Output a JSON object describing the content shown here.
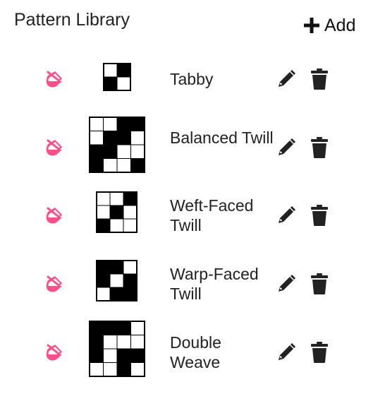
{
  "header": {
    "title": "Pattern Library",
    "add_label": "Add",
    "add_icon": "plus-icon"
  },
  "colors": {
    "accent": "#ff4f86",
    "icon_dark": "#222222"
  },
  "patterns": [
    {
      "name": "Tabby",
      "grid": [
        [
          0,
          1
        ],
        [
          1,
          0
        ]
      ]
    },
    {
      "name": "Balanced Twill",
      "grid": [
        [
          0,
          0,
          1,
          1
        ],
        [
          0,
          1,
          1,
          0
        ],
        [
          1,
          1,
          0,
          0
        ],
        [
          1,
          0,
          0,
          1
        ]
      ]
    },
    {
      "name": "Weft-Faced Twill",
      "grid": [
        [
          0,
          0,
          1
        ],
        [
          0,
          1,
          0
        ],
        [
          1,
          0,
          0
        ]
      ]
    },
    {
      "name": "Warp-Faced Twill",
      "grid": [
        [
          1,
          1,
          0
        ],
        [
          1,
          0,
          1
        ],
        [
          0,
          1,
          1
        ]
      ]
    },
    {
      "name": "Double Weave",
      "grid": [
        [
          1,
          1,
          1,
          0
        ],
        [
          1,
          0,
          0,
          0
        ],
        [
          1,
          0,
          1,
          1
        ],
        [
          0,
          0,
          1,
          0
        ]
      ]
    }
  ],
  "row_icons": {
    "fill": "paint-bucket-icon",
    "edit": "pencil-icon",
    "delete": "trash-icon"
  }
}
